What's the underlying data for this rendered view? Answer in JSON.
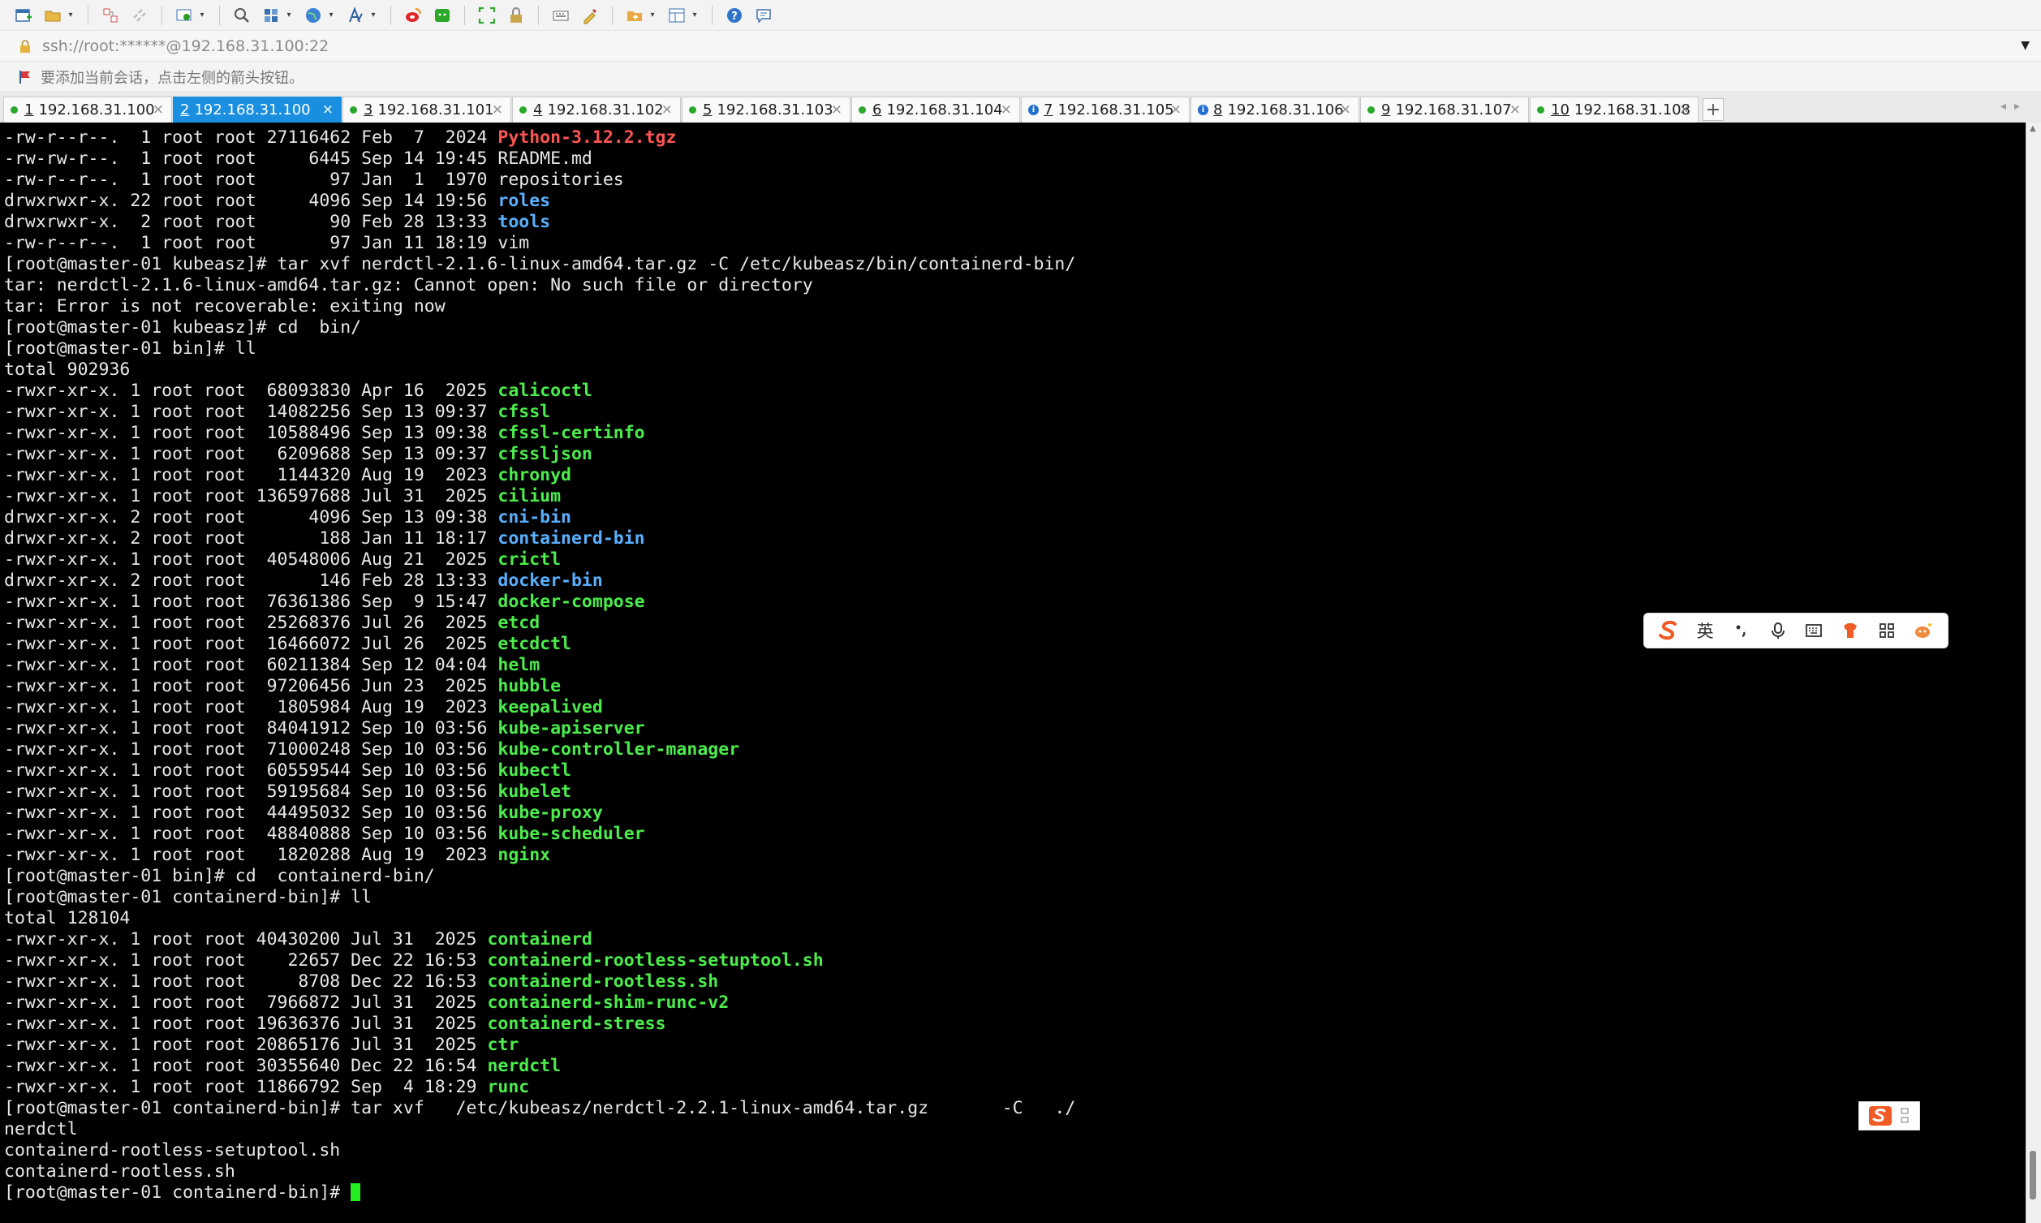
{
  "address": {
    "url": "ssh://root:******@192.168.31.100:22"
  },
  "hint": {
    "text": "要添加当前会话，点击左侧的箭头按钮。"
  },
  "tabs": [
    {
      "num": "1",
      "label": "192.168.31.100",
      "status": "green"
    },
    {
      "num": "2",
      "label": "192.168.31.100",
      "status": "active"
    },
    {
      "num": "3",
      "label": "192.168.31.101",
      "status": "green"
    },
    {
      "num": "4",
      "label": "192.168.31.102",
      "status": "green"
    },
    {
      "num": "5",
      "label": "192.168.31.103",
      "status": "green"
    },
    {
      "num": "6",
      "label": "192.168.31.104",
      "status": "green"
    },
    {
      "num": "7",
      "label": "192.168.31.105",
      "status": "info"
    },
    {
      "num": "8",
      "label": "192.168.31.106",
      "status": "info"
    },
    {
      "num": "9",
      "label": "192.168.31.107",
      "status": "green"
    },
    {
      "num": "10",
      "label": "192.168.31.108",
      "status": "green"
    }
  ],
  "ime": {
    "lang_label": "英"
  },
  "terminal": {
    "lines": [
      {
        "text": "-rw-r--r--.  1 root root 27116462 Feb  7  2024 ",
        "name": "Python-3.12.2.tgz",
        "color": "red"
      },
      {
        "text": "-rw-rw-r--.  1 root root     6445 Sep 14 19:45 ",
        "name": "README.md",
        "color": "plain"
      },
      {
        "text": "-rw-r--r--.  1 root root       97 Jan  1  1970 ",
        "name": "repositories",
        "color": "plain"
      },
      {
        "text": "drwxrwxr-x. 22 root root     4096 Sep 14 19:56 ",
        "name": "roles",
        "color": "blue"
      },
      {
        "text": "drwxrwxr-x.  2 root root       90 Feb 28 13:33 ",
        "name": "tools",
        "color": "blue"
      },
      {
        "text": "-rw-r--r--.  1 root root       97 Jan 11 18:19 ",
        "name": "vim",
        "color": "plain"
      },
      {
        "text": "[root@master-01 kubeasz]# tar xvf nerdctl-2.1.6-linux-amd64.tar.gz -C /etc/kubeasz/bin/containerd-bin/",
        "name": "",
        "color": "plain"
      },
      {
        "text": "tar: nerdctl-2.1.6-linux-amd64.tar.gz: Cannot open: No such file or directory",
        "name": "",
        "color": "plain"
      },
      {
        "text": "tar: Error is not recoverable: exiting now",
        "name": "",
        "color": "plain"
      },
      {
        "text": "[root@master-01 kubeasz]# cd  bin/",
        "name": "",
        "color": "plain"
      },
      {
        "text": "[root@master-01 bin]# ll",
        "name": "",
        "color": "plain"
      },
      {
        "text": "total 902936",
        "name": "",
        "color": "plain"
      },
      {
        "text": "-rwxr-xr-x. 1 root root  68093830 Apr 16  2025 ",
        "name": "calicoctl",
        "color": "green"
      },
      {
        "text": "-rwxr-xr-x. 1 root root  14082256 Sep 13 09:37 ",
        "name": "cfssl",
        "color": "green"
      },
      {
        "text": "-rwxr-xr-x. 1 root root  10588496 Sep 13 09:38 ",
        "name": "cfssl-certinfo",
        "color": "green"
      },
      {
        "text": "-rwxr-xr-x. 1 root root   6209688 Sep 13 09:37 ",
        "name": "cfssljson",
        "color": "green"
      },
      {
        "text": "-rwxr-xr-x. 1 root root   1144320 Aug 19  2023 ",
        "name": "chronyd",
        "color": "green"
      },
      {
        "text": "-rwxr-xr-x. 1 root root 136597688 Jul 31  2025 ",
        "name": "cilium",
        "color": "green"
      },
      {
        "text": "drwxr-xr-x. 2 root root      4096 Sep 13 09:38 ",
        "name": "cni-bin",
        "color": "blue"
      },
      {
        "text": "drwxr-xr-x. 2 root root       188 Jan 11 18:17 ",
        "name": "containerd-bin",
        "color": "blue"
      },
      {
        "text": "-rwxr-xr-x. 1 root root  40548006 Aug 21  2025 ",
        "name": "crictl",
        "color": "green"
      },
      {
        "text": "drwxr-xr-x. 2 root root       146 Feb 28 13:33 ",
        "name": "docker-bin",
        "color": "blue"
      },
      {
        "text": "-rwxr-xr-x. 1 root root  76361386 Sep  9 15:47 ",
        "name": "docker-compose",
        "color": "green"
      },
      {
        "text": "-rwxr-xr-x. 1 root root  25268376 Jul 26  2025 ",
        "name": "etcd",
        "color": "green"
      },
      {
        "text": "-rwxr-xr-x. 1 root root  16466072 Jul 26  2025 ",
        "name": "etcdctl",
        "color": "green"
      },
      {
        "text": "-rwxr-xr-x. 1 root root  60211384 Sep 12 04:04 ",
        "name": "helm",
        "color": "green"
      },
      {
        "text": "-rwxr-xr-x. 1 root root  97206456 Jun 23  2025 ",
        "name": "hubble",
        "color": "green"
      },
      {
        "text": "-rwxr-xr-x. 1 root root   1805984 Aug 19  2023 ",
        "name": "keepalived",
        "color": "green"
      },
      {
        "text": "-rwxr-xr-x. 1 root root  84041912 Sep 10 03:56 ",
        "name": "kube-apiserver",
        "color": "green"
      },
      {
        "text": "-rwxr-xr-x. 1 root root  71000248 Sep 10 03:56 ",
        "name": "kube-controller-manager",
        "color": "green"
      },
      {
        "text": "-rwxr-xr-x. 1 root root  60559544 Sep 10 03:56 ",
        "name": "kubectl",
        "color": "green"
      },
      {
        "text": "-rwxr-xr-x. 1 root root  59195684 Sep 10 03:56 ",
        "name": "kubelet",
        "color": "green"
      },
      {
        "text": "-rwxr-xr-x. 1 root root  44495032 Sep 10 03:56 ",
        "name": "kube-proxy",
        "color": "green"
      },
      {
        "text": "-rwxr-xr-x. 1 root root  48840888 Sep 10 03:56 ",
        "name": "kube-scheduler",
        "color": "green"
      },
      {
        "text": "-rwxr-xr-x. 1 root root   1820288 Aug 19  2023 ",
        "name": "nginx",
        "color": "green"
      },
      {
        "text": "[root@master-01 bin]# cd  containerd-bin/",
        "name": "",
        "color": "plain"
      },
      {
        "text": "[root@master-01 containerd-bin]# ll",
        "name": "",
        "color": "plain"
      },
      {
        "text": "total 128104",
        "name": "",
        "color": "plain"
      },
      {
        "text": "-rwxr-xr-x. 1 root root 40430200 Jul 31  2025 ",
        "name": "containerd",
        "color": "green"
      },
      {
        "text": "-rwxr-xr-x. 1 root root    22657 Dec 22 16:53 ",
        "name": "containerd-rootless-setuptool.sh",
        "color": "green"
      },
      {
        "text": "-rwxr-xr-x. 1 root root     8708 Dec 22 16:53 ",
        "name": "containerd-rootless.sh",
        "color": "green"
      },
      {
        "text": "-rwxr-xr-x. 1 root root  7966872 Jul 31  2025 ",
        "name": "containerd-shim-runc-v2",
        "color": "green"
      },
      {
        "text": "-rwxr-xr-x. 1 root root 19636376 Jul 31  2025 ",
        "name": "containerd-stress",
        "color": "green"
      },
      {
        "text": "-rwxr-xr-x. 1 root root 20865176 Jul 31  2025 ",
        "name": "ctr",
        "color": "green"
      },
      {
        "text": "-rwxr-xr-x. 1 root root 30355640 Dec 22 16:54 ",
        "name": "nerdctl",
        "color": "green"
      },
      {
        "text": "-rwxr-xr-x. 1 root root 11866792 Sep  4 18:29 ",
        "name": "runc",
        "color": "green"
      },
      {
        "text": "[root@master-01 containerd-bin]# tar xvf   /etc/kubeasz/nerdctl-2.2.1-linux-amd64.tar.gz       -C   ./",
        "name": "",
        "color": "plain"
      },
      {
        "text": "nerdctl",
        "name": "",
        "color": "plain"
      },
      {
        "text": "containerd-rootless-setuptool.sh",
        "name": "",
        "color": "plain"
      },
      {
        "text": "containerd-rootless.sh",
        "name": "",
        "color": "plain"
      }
    ],
    "prompt": "[root@master-01 containerd-bin]# "
  },
  "colors": {
    "tab_active": "#1a8fe0",
    "status_green": "#2aa82a",
    "term_red": "#ff5555",
    "term_blue": "#5ab0ff",
    "term_green": "#4bec4b",
    "cursor": "#22ee22"
  },
  "icons": [
    "new-session-icon",
    "open-folder-icon",
    "connect-icon",
    "disconnect-icon",
    "properties-icon",
    "find-icon",
    "transfer-icon",
    "globe-icon",
    "font-icon",
    "weibo-icon",
    "wechat-icon",
    "fullscreen-icon",
    "lock-icon",
    "keyboard-icon",
    "script-icon",
    "sftp-icon",
    "layout-icon",
    "help-icon",
    "chat-icon"
  ]
}
